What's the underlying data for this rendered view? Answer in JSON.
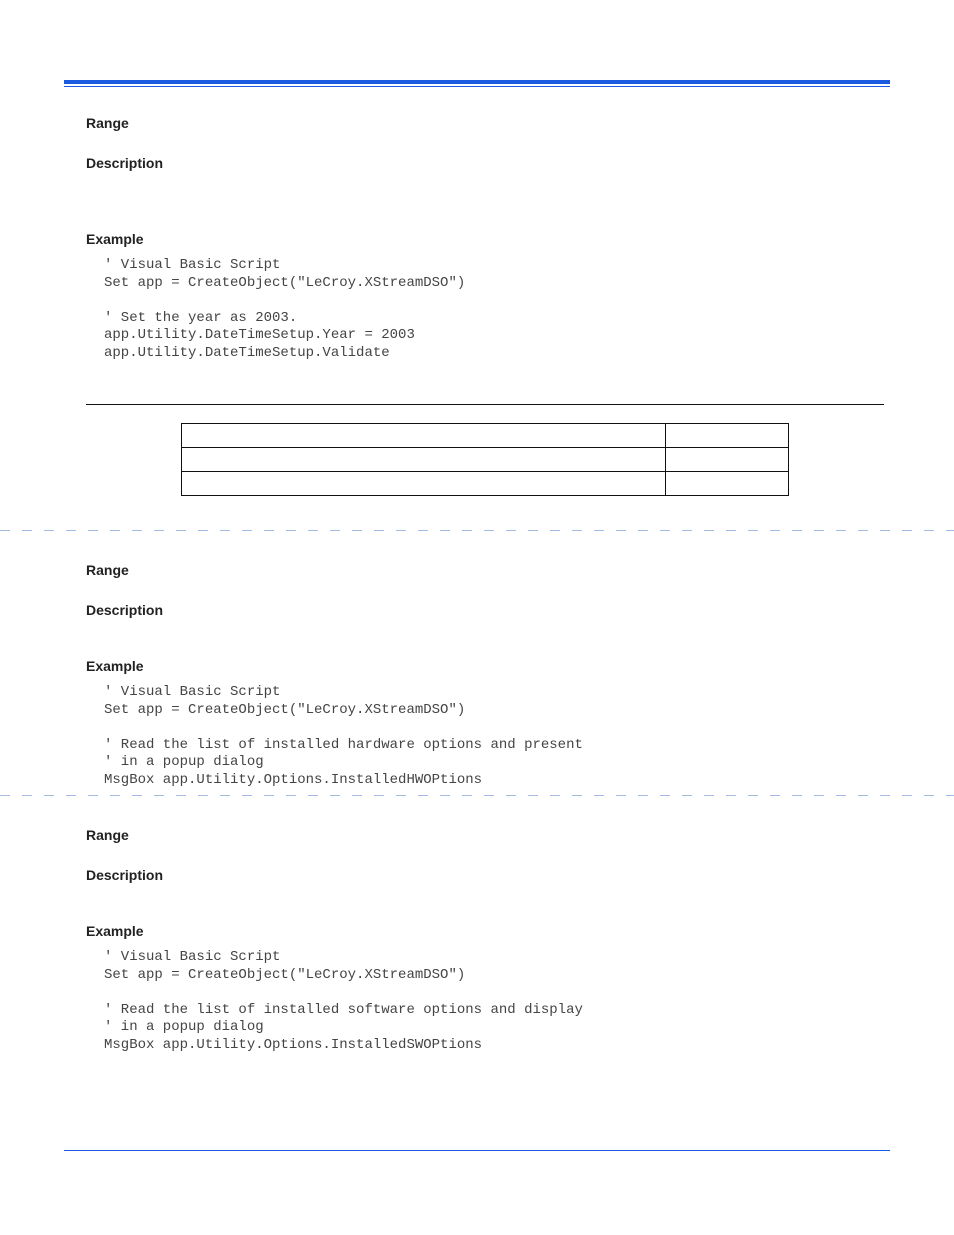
{
  "sec1": {
    "range": "Range",
    "description": "Description",
    "example_label": "Example",
    "code": "' Visual Basic Script\nSet app = CreateObject(\"LeCroy.XStreamDSO\")\n\n' Set the year as 2003.\napp.Utility.DateTimeSetup.Year = 2003\napp.Utility.DateTimeSetup.Validate"
  },
  "sec2": {
    "range": "Range",
    "description": "Description",
    "example_label": "Example",
    "code": "' Visual Basic Script\nSet app = CreateObject(\"LeCroy.XStreamDSO\")\n\n' Read the list of installed hardware options and present \n' in a popup dialog\nMsgBox app.Utility.Options.InstalledHWOPtions"
  },
  "sec3": {
    "range": "Range",
    "description": "Description",
    "example_label": "Example",
    "code": "' Visual Basic Script\nSet app = CreateObject(\"LeCroy.XStreamDSO\")\n\n' Read the list of installed software options and display \n' in a popup dialog\nMsgBox app.Utility.Options.InstalledSWOPtions"
  }
}
